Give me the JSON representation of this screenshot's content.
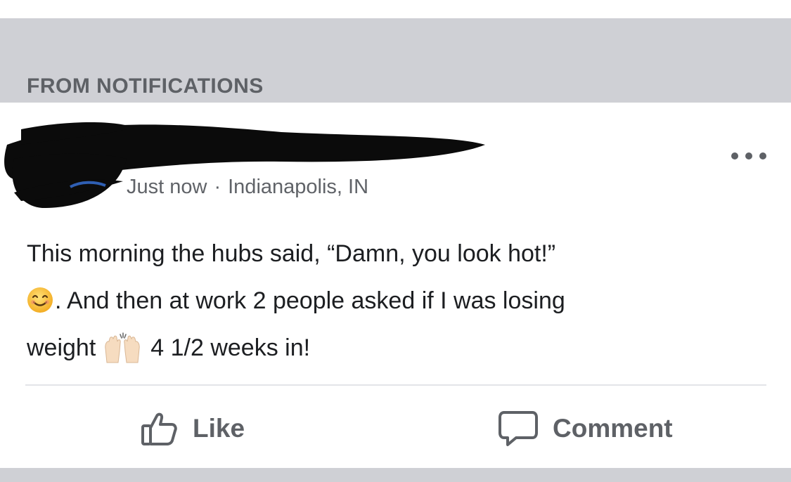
{
  "section_header": {
    "label": "FROM NOTIFICATIONS"
  },
  "post": {
    "timestamp": "Just now",
    "separator": "·",
    "location": "Indianapolis, IN",
    "text_line1": "This morning the hubs said, “Damn, you look hot!”",
    "text_line2": ". And then at work 2 people asked if I was losing",
    "text_line3a": "weight",
    "text_line3b": "4 1/2 weeks in!",
    "emojis": [
      "smiling-face-emoji",
      "raising-hands-emoji"
    ]
  },
  "actions": {
    "like_label": "Like",
    "comment_label": "Comment"
  },
  "icons": {
    "more": "more-options-icon",
    "like": "thumbs-up-icon",
    "comment": "comment-bubble-icon"
  },
  "colors": {
    "header_bg": "#cfd0d5",
    "text": "#1c1e21",
    "muted": "#5e6166"
  }
}
